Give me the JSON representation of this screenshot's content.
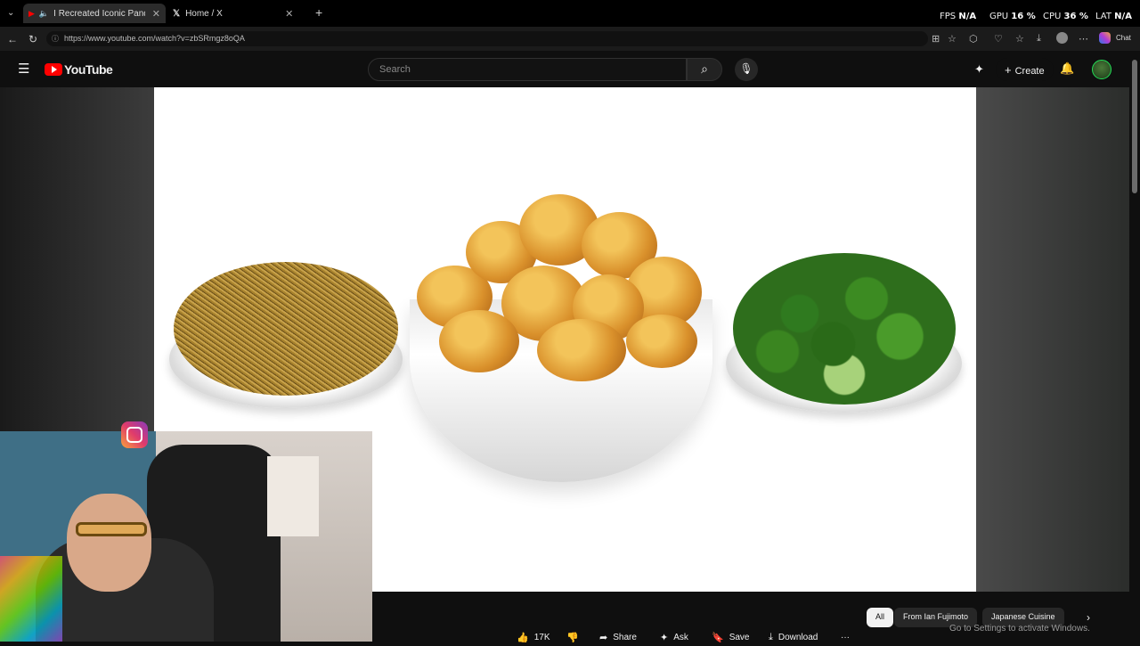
{
  "browser": {
    "tabs": [
      {
        "label": "I Recreated Iconic Panda Exp",
        "active": true
      },
      {
        "label": "Home / X",
        "active": false
      }
    ],
    "new_tab_symbol": "+",
    "url": "https://www.youtube.com/watch?v=zbSRmgz8oQA",
    "chat_label": "Chat"
  },
  "hud": {
    "fps_label": "FPS",
    "fps_value": "N/A",
    "gpu_label": "GPU",
    "gpu_value": "16 %",
    "cpu_label": "CPU",
    "cpu_value": "36 %",
    "lat_label": "LAT",
    "lat_value": "N/A"
  },
  "youtube": {
    "logo_text": "YouTube",
    "search_placeholder": "Search",
    "create_label": "Create"
  },
  "actions": {
    "like_count": "17K",
    "share_label": "Share",
    "ask_label": "Ask",
    "save_label": "Save",
    "download_label": "Download",
    "more_label": "···"
  },
  "chips": [
    {
      "label": "All",
      "selected": true
    },
    {
      "label": "From Ian Fujimoto",
      "selected": false
    },
    {
      "label": "Japanese Cuisine",
      "selected": false
    }
  ],
  "windows_notice": {
    "line1": "Go to Settings to activate Windows."
  },
  "colors": {
    "yt_red": "#ff0000",
    "background": "#0f0f0f"
  }
}
